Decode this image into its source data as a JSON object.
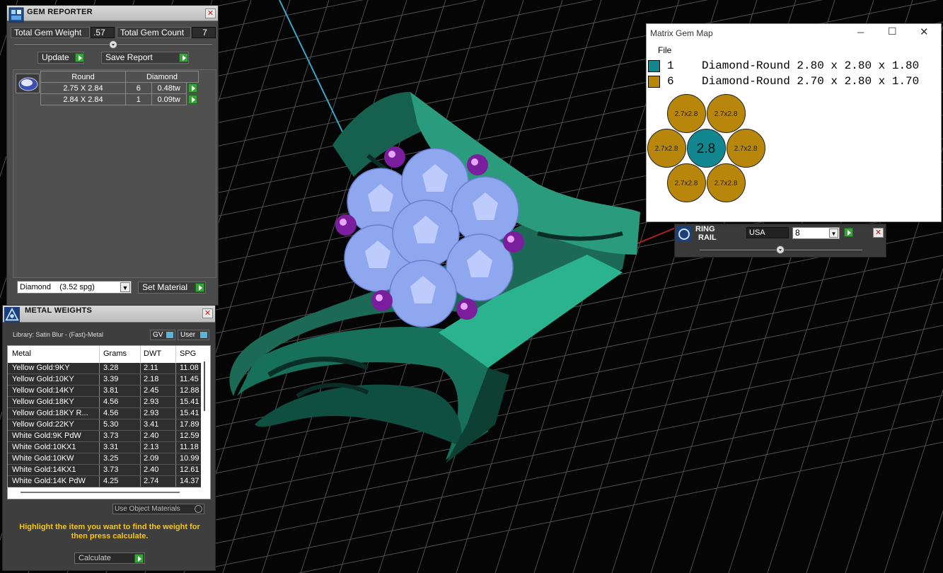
{
  "gem_reporter": {
    "title": "GEM REPORTER",
    "total_weight_label": "Total Gem Weight",
    "total_weight_value": ".57",
    "total_count_label": "Total Gem Count",
    "total_count_value": "7",
    "update_label": "Update",
    "save_report_label": "Save Report",
    "col_shape": "Round",
    "col_material": "Diamond",
    "rows": [
      {
        "size": "2.75 X 2.84",
        "count": "6",
        "weight": "0.48tw"
      },
      {
        "size": "2.84 X 2.84",
        "count": "1",
        "weight": "0.09tw"
      }
    ],
    "material_select": "Diamond    (3.52 spg)",
    "set_material_label": "Set Material"
  },
  "metal_weights": {
    "title": "METAL WEIGHTS",
    "library": "Library: Satin Blur - (Fast)-Metal",
    "gv_label": "GV",
    "user_label": "User",
    "headers": [
      "Metal",
      "Grams",
      "DWT",
      "SPG"
    ],
    "rows": [
      [
        "Yellow Gold:9KY",
        "3.28",
        "2.11",
        "11.08"
      ],
      [
        "Yellow Gold:10KY",
        "3.39",
        "2.18",
        "11.45"
      ],
      [
        "Yellow Gold:14KY",
        "3.81",
        "2.45",
        "12.88"
      ],
      [
        "Yellow Gold:18KY",
        "4.56",
        "2.93",
        "15.41"
      ],
      [
        "Yellow Gold:18KY R...",
        "4.56",
        "2.93",
        "15.41"
      ],
      [
        "Yellow Gold:22KY",
        "5.30",
        "3.41",
        "17.89"
      ],
      [
        "White Gold:9K PdW",
        "3.73",
        "2.40",
        "12.59"
      ],
      [
        "White Gold:10KX1",
        "3.31",
        "2.13",
        "11.18"
      ],
      [
        "White Gold:10KW",
        "3.25",
        "2.09",
        "10.99"
      ],
      [
        "White Gold:14KX1",
        "3.73",
        "2.40",
        "12.61"
      ],
      [
        "White Gold:14K PdW",
        "4.25",
        "2.74",
        "14.37"
      ]
    ],
    "use_object_materials": "Use Object Materials",
    "hint": "Highlight the item you want to find the weight for then press calculate.",
    "calculate_label": "Calculate"
  },
  "gem_map": {
    "title": "Matrix Gem Map",
    "menu_file": "File",
    "legend": [
      {
        "count": "1",
        "desc": "Diamond-Round 2.80 x 2.80 x 1.80",
        "color": "#12878f"
      },
      {
        "count": "6",
        "desc": "Diamond-Round 2.70 x 2.80 x 1.70",
        "color": "#b8860b"
      }
    ],
    "center_label": "2.8",
    "outer_label": "2.7x2.8",
    "minimize_icon": "minimize-icon",
    "maximize_icon": "maximize-icon",
    "close_icon": "close-icon"
  },
  "ring_rail": {
    "title_line1": "RING",
    "title_line2": "RAIL",
    "region": "USA",
    "size": "8"
  }
}
